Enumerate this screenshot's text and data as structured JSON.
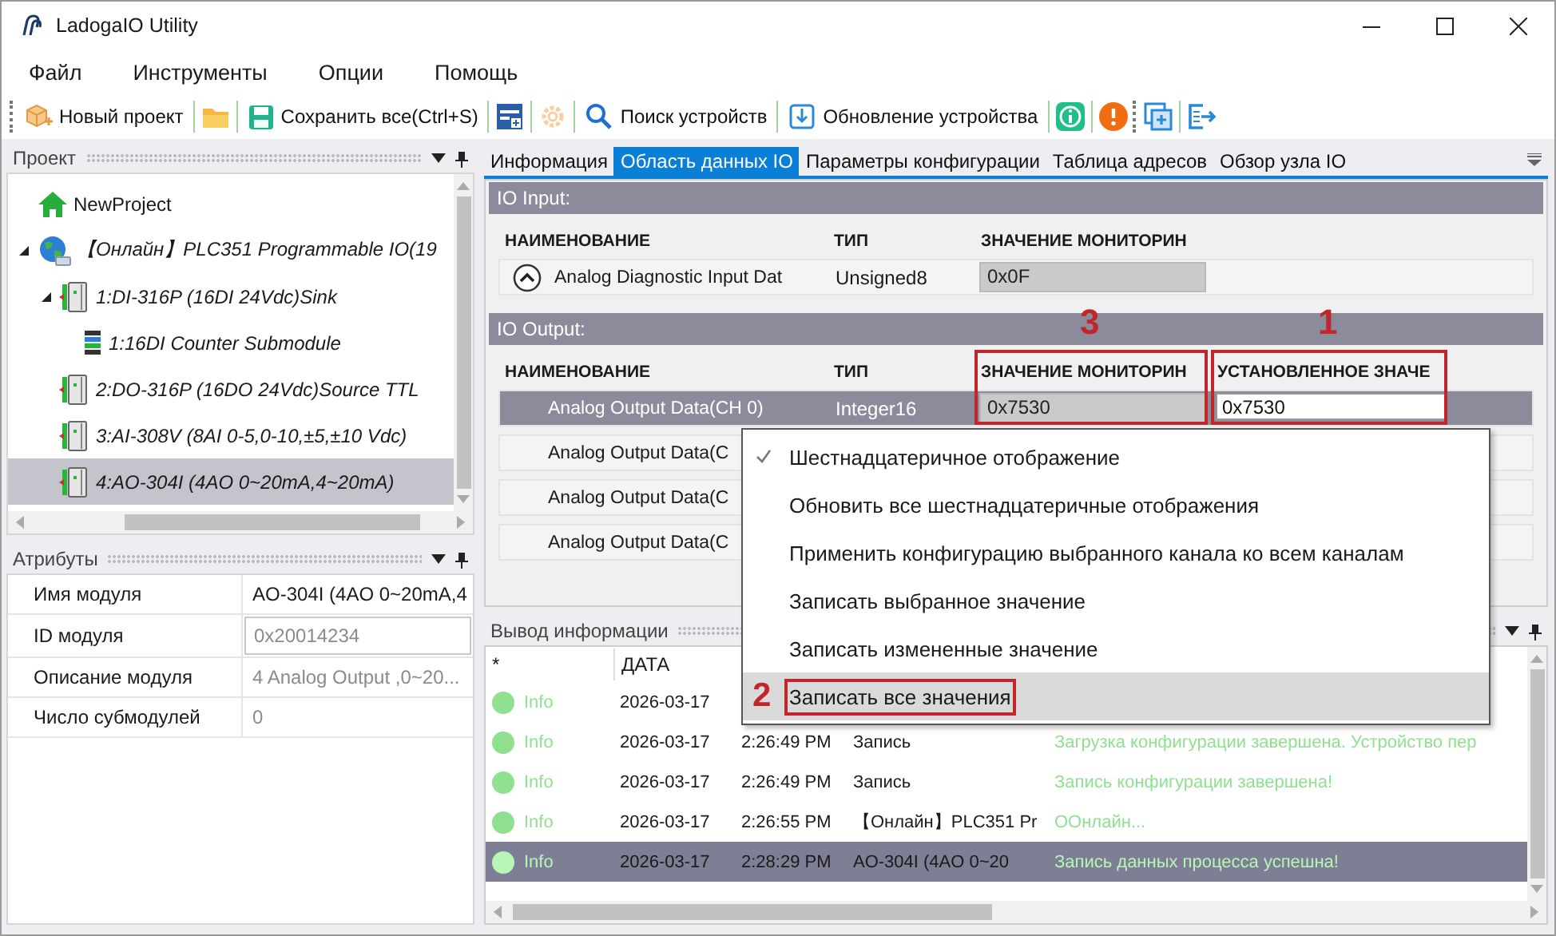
{
  "window": {
    "title": "LadogaIO Utility"
  },
  "menu": [
    "Файл",
    "Инструменты",
    "Опции",
    "Помощь"
  ],
  "toolbar": [
    "Новый проект",
    "Сохранить все(Ctrl+S)",
    "Поиск устройств",
    "Обновление устройства"
  ],
  "project_panel": {
    "title": "Проект",
    "tree": [
      {
        "label": "NewProject",
        "kind": "project",
        "selected": false
      },
      {
        "label": "【Онлайн】PLC351 Programmable IO(19",
        "kind": "device",
        "expanded": true,
        "selected": false,
        "children": [
          {
            "label": "1:DI-316P (16DI 24Vdc)Sink",
            "kind": "module",
            "expanded": true,
            "selected": false,
            "children": [
              {
                "label": "1:16DI Counter Submodule",
                "kind": "submodule",
                "selected": false
              }
            ]
          },
          {
            "label": "2:DO-316P (16DO 24Vdc)Source TTL",
            "kind": "module",
            "selected": false
          },
          {
            "label": "3:AI-308V (8AI 0-5,0-10,±5,±10 Vdc)",
            "kind": "module",
            "selected": false
          },
          {
            "label": "4:AO-304I (4AO 0~20mA,4~20mA)",
            "kind": "module",
            "selected": true
          }
        ]
      }
    ]
  },
  "attributes": {
    "title": "Атрибуты",
    "rows": [
      {
        "name": "Имя модуля",
        "value": "AO-304I (4AO 0~20mA,4",
        "kind": "text",
        "disabled": false
      },
      {
        "name": "ID модуля",
        "value": "0x20014234",
        "kind": "field",
        "disabled": true
      },
      {
        "name": "Описание модуля",
        "value": "4 Analog Output ,0~20...",
        "kind": "text",
        "disabled": true
      },
      {
        "name": "Число субмодулей",
        "value": "0",
        "kind": "text",
        "disabled": true
      }
    ]
  },
  "tabs": [
    {
      "label": "Информация",
      "selected": false
    },
    {
      "label": "Область данных IO",
      "selected": true
    },
    {
      "label": "Параметры конфигурации",
      "selected": false
    },
    {
      "label": "Таблица адресов",
      "selected": false
    },
    {
      "label": "Обзор узла IO",
      "selected": false
    }
  ],
  "io_input": {
    "title": "IO Input:",
    "columns": [
      {
        "label": "НАИМЕНОВАНИЕ"
      },
      {
        "label": "ТИП"
      },
      {
        "label": "ЗНАЧЕНИЕ МОНИТОРИН"
      }
    ],
    "rows": [
      {
        "name": "Analog Diagnostic Input Dat",
        "type": "Unsigned8",
        "monitor": "0x0F",
        "expanded": true,
        "selected": false
      }
    ]
  },
  "io_output": {
    "title": "IO Output:",
    "columns": [
      {
        "label": "НАИМЕНОВАНИЕ"
      },
      {
        "label": "ТИП"
      },
      {
        "label": "ЗНАЧЕНИЕ МОНИТОРИН",
        "callout": "3"
      },
      {
        "label": "УСТАНОВЛЕННОЕ ЗНАЧЕ",
        "callout": "1"
      }
    ],
    "rows": [
      {
        "name": "Analog Output Data(CH 0)",
        "type": "Integer16",
        "monitor": "0x7530",
        "setpoint": "0x7530",
        "selected": true
      },
      {
        "name": "Analog Output Data(C",
        "selected": false
      },
      {
        "name": "Analog Output Data(C",
        "selected": false
      },
      {
        "name": "Analog Output Data(C",
        "selected": false
      }
    ]
  },
  "context_menu": {
    "items": [
      {
        "label": "Шестнадцатеричное отображение",
        "checked": true,
        "selected": false
      },
      {
        "label": "Обновить все шестнадцатеричные отображения",
        "checked": false,
        "selected": false
      },
      {
        "label": "Применить конфигурацию выбранного канала ко всем каналам",
        "checked": false,
        "selected": false
      },
      {
        "label": "Записать выбранное значение",
        "checked": false,
        "selected": false
      },
      {
        "label": "Записать измененные значение",
        "checked": false,
        "selected": false
      },
      {
        "label": "Записать все значения",
        "checked": false,
        "selected": true,
        "callout": "2"
      }
    ]
  },
  "log": {
    "title": "Вывод информации",
    "columns": [
      "*",
      "ДАТА"
    ],
    "rows": [
      {
        "kind": "info",
        "level": "Info",
        "date": "2026-03-17",
        "selected": false
      },
      {
        "kind": "info",
        "level": "Info",
        "date": "2026-03-17",
        "time": "2:26:49 PM",
        "source": "Запись",
        "message": "Загрузка конфигурации завершена. Устройство пер",
        "selected": false
      },
      {
        "kind": "info",
        "level": "Info",
        "date": "2026-03-17",
        "time": "2:26:49 PM",
        "source": "Запись",
        "message": "Запись конфигурации завершена!",
        "selected": false
      },
      {
        "kind": "info",
        "level": "Info",
        "date": "2026-03-17",
        "time": "2:26:55 PM",
        "source": "【Онлайн】PLC351 Pr",
        "message": "OОнлайн...",
        "selected": false
      },
      {
        "kind": "info",
        "level": "Info",
        "date": "2026-03-17",
        "time": "2:28:29 PM",
        "source": "AO-304I (4AO 0~20",
        "message": "Запись данных процесса успешна!",
        "selected": true
      }
    ]
  }
}
